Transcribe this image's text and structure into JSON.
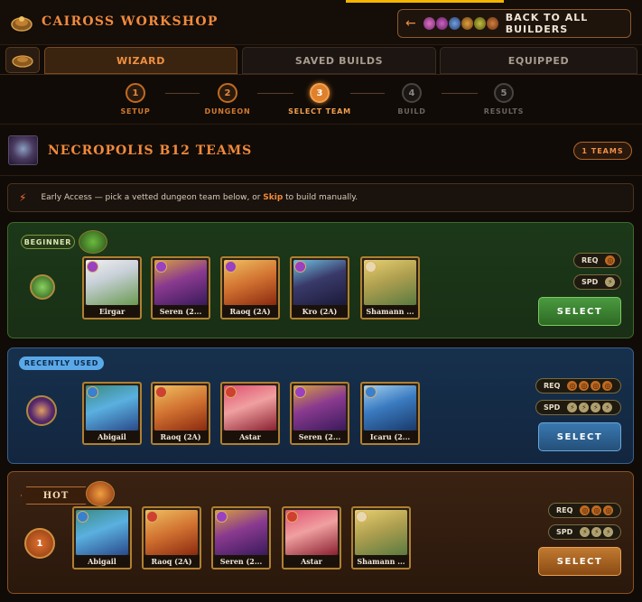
{
  "app": {
    "title": "CAIROSS WORKSHOP",
    "back_label": "BACK TO ALL BUILDERS"
  },
  "tabs": [
    {
      "label": "WIZARD",
      "active": true
    },
    {
      "label": "SAVED BUILDS",
      "active": false
    },
    {
      "label": "EQUIPPED",
      "active": false
    }
  ],
  "steps": [
    {
      "num": "1",
      "label": "SETUP",
      "state": "done"
    },
    {
      "num": "2",
      "label": "DUNGEON",
      "state": "done"
    },
    {
      "num": "3",
      "label": "SELECT TEAM",
      "state": "current"
    },
    {
      "num": "4",
      "label": "BUILD",
      "state": "todo"
    },
    {
      "num": "5",
      "label": "RESULTS",
      "state": "todo"
    }
  ],
  "dungeon": {
    "title": "NECROPOLIS B12 TEAMS",
    "teams_count": "1 TEAMS"
  },
  "notice": {
    "pre": "Early Access — pick a vetted dungeon team below, or",
    "skip": "Skip",
    "post": "to build manually."
  },
  "cards": [
    {
      "badge": "BEGINNER",
      "req_label": "REQ",
      "spd_label": "SPD",
      "req_icons": 1,
      "spd_icons": 1,
      "select_label": "SELECT",
      "monsters": [
        "Eirgar",
        "Seren (2...",
        "Raoq (2A)",
        "Kro (2A)",
        "Shamann ..."
      ]
    },
    {
      "badge": "RECENTLY USED",
      "req_label": "REQ",
      "spd_label": "SPD",
      "req_icons": 4,
      "spd_icons": 4,
      "select_label": "SELECT",
      "monsters": [
        "Abigail",
        "Raoq (2A)",
        "Astar",
        "Seren (2...",
        "Icaru (2..."
      ]
    },
    {
      "badge": "HOT",
      "rank": "1",
      "req_label": "REQ",
      "spd_label": "SPD",
      "req_icons": 3,
      "spd_icons": 3,
      "select_label": "SELECT",
      "monsters": [
        "Abigail",
        "Raoq (2A)",
        "Seren (2...",
        "Astar",
        "Shamann ..."
      ]
    }
  ],
  "colors": {
    "accent": "#f08a3c",
    "green_card": "#1b3818",
    "blue_card": "#16304c",
    "orange_card": "#3a2212"
  }
}
